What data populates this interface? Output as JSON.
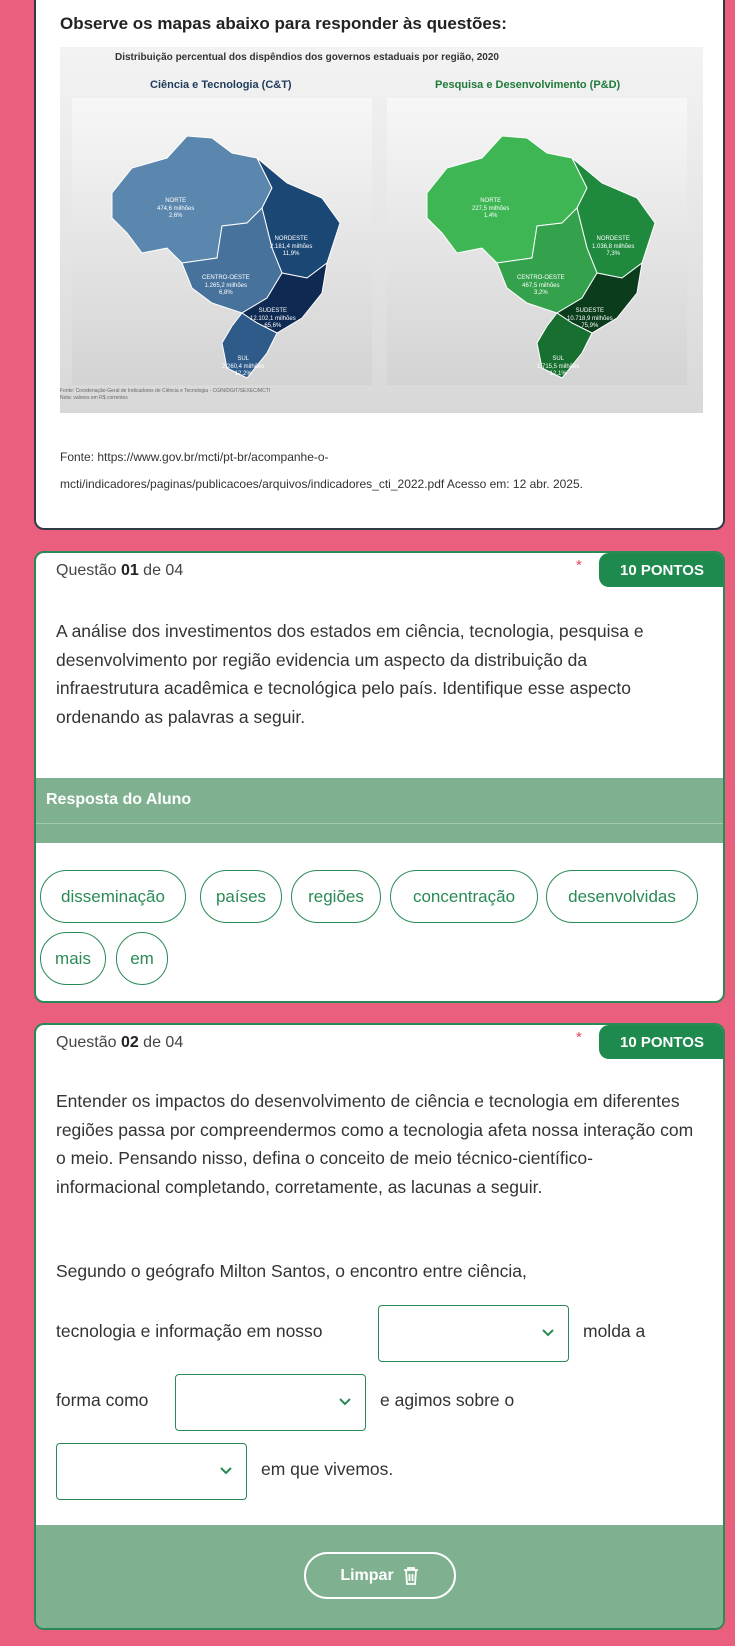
{
  "intro": {
    "title": "Observe os mapas abaixo para responder às questões:",
    "figure": {
      "title": "Distribuição percentual dos dispêndios dos governos estaduais por região, 2020",
      "left_map_title": "Ciência e Tecnologia (C&T)",
      "right_map_title": "Pesquisa e Desenvolvimento (P&D)",
      "ct_regions": [
        {
          "name": "NORTE",
          "value": "474,6 milhões",
          "pct": "2,6%"
        },
        {
          "name": "NORDESTE",
          "value": "2.181,4 milhões",
          "pct": "11,9%"
        },
        {
          "name": "CENTRO-OESTE",
          "value": "1.265,2 milhões",
          "pct": "6,8%"
        },
        {
          "name": "SUDESTE",
          "value": "12.102,1 milhões",
          "pct": "65,6%"
        },
        {
          "name": "SUL",
          "value": "2.260,4 milhões",
          "pct": "12,2%"
        }
      ],
      "pd_regions": [
        {
          "name": "NORTE",
          "value": "227,5 milhões",
          "pct": "1,4%"
        },
        {
          "name": "NORDESTE",
          "value": "1.036,8 milhões",
          "pct": "7,3%"
        },
        {
          "name": "CENTRO-OESTE",
          "value": "467,5 milhões",
          "pct": "3,2%"
        },
        {
          "name": "SUDESTE",
          "value": "10.718,9 milhões",
          "pct": "75,9%"
        },
        {
          "name": "SUL",
          "value": "1.715,5 milhões",
          "pct": "12,1%"
        }
      ],
      "source_line1": "Fonte: Coordenação-Geral de Indicadores de Ciência e Tecnologia - CGIN/DGIT/SEXEC/MCTI",
      "source_line2": "Nota: valores em R$ correntes"
    },
    "fonte_line1": "Fonte: https://www.gov.br/mcti/pt-br/acompanhe-o-",
    "fonte_line2": "mcti/indicadores/paginas/publicacoes/arquivos/indicadores_cti_2022.pdf Acesso em: 12 abr. 2025."
  },
  "q1": {
    "prefix": "Questão ",
    "number": "01",
    "suffix": " de 04",
    "star": "*",
    "points": "10 PONTOS",
    "text": "A análise dos investimentos dos estados em ciência, tecnologia, pesquisa e desenvolvimento por região evidencia um aspecto da distribuição da infraestrutura acadêmica e tecnológica pelo país. Identifique esse aspecto ordenando as palavras a seguir.",
    "answer_label": "Resposta do Aluno",
    "chips": [
      "disseminação",
      "países",
      "regiões",
      "concentração",
      "desenvolvidas",
      "mais",
      "em"
    ]
  },
  "q2": {
    "prefix": "Questão ",
    "number": "02",
    "suffix": " de 04",
    "star": "*",
    "points": "10 PONTOS",
    "text": "Entender os impactos do desenvolvimento de ciência e tecnologia em diferentes regiões passa por compreendermos como a tecnologia afeta nossa interação com o meio. Pensando nisso, defina o conceito de meio técnico-científico-informacional completando, corretamente, as lacunas a seguir.",
    "line1": "Segundo o geógrafo Milton Santos, o encontro entre ciência,",
    "line2a": "tecnologia e informação em nosso",
    "line2b": "molda a",
    "line3a": "forma como",
    "line3b": "e agimos sobre o",
    "line4": "em que vivemos.",
    "clear_label": "Limpar"
  },
  "colors": {
    "page_bg": "#ea5f7e",
    "accent_green": "#1f8a4e",
    "answer_bar": "#7fb190"
  }
}
